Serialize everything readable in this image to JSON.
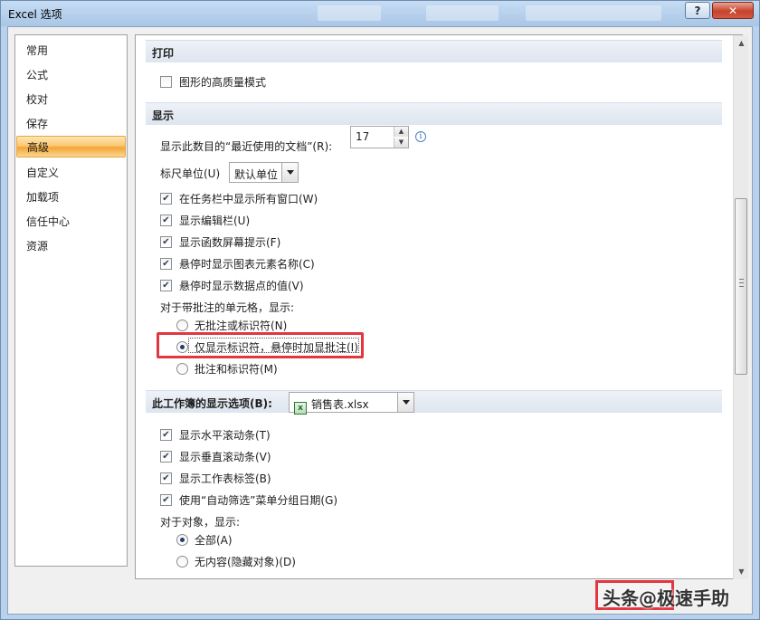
{
  "window": {
    "title": "Excel 选项",
    "help_label": "?",
    "close_label": "✕"
  },
  "nav": {
    "items": [
      {
        "label": "常用",
        "active": false
      },
      {
        "label": "公式",
        "active": false
      },
      {
        "label": "校对",
        "active": false
      },
      {
        "label": "保存",
        "active": false
      },
      {
        "label": "高级",
        "active": true
      },
      {
        "label": "自定义",
        "active": false
      },
      {
        "label": "加载项",
        "active": false
      },
      {
        "label": "信任中心",
        "active": false
      },
      {
        "label": "资源",
        "active": false
      }
    ]
  },
  "print_section": {
    "title": "打印",
    "high_quality_graphics": {
      "label": "图形的高质量模式",
      "checked": false
    }
  },
  "display_section": {
    "title": "显示",
    "recent_docs_label": "显示此数目的“最近使用的文档”(R):",
    "recent_docs_value": "17",
    "ruler_units_label": "标尺单位(U)",
    "ruler_units_value": "默认单位",
    "checkboxes": [
      {
        "label": "在任务栏中显示所有窗口(W)",
        "checked": true
      },
      {
        "label": "显示编辑栏(U)",
        "checked": true
      },
      {
        "label": "显示函数屏幕提示(F)",
        "checked": true
      },
      {
        "label": "悬停时显示图表元素名称(C)",
        "checked": true
      },
      {
        "label": "悬停时显示数据点的值(V)",
        "checked": true
      }
    ],
    "comments_label": "对于带批注的单元格，显示:",
    "comment_options": [
      {
        "label": "无批注或标识符(N)",
        "selected": false
      },
      {
        "label": "仅显示标识符，悬停时加显批注(I)",
        "selected": true
      },
      {
        "label": "批注和标识符(M)",
        "selected": false
      }
    ]
  },
  "workbook_section": {
    "title": "此工作簿的显示选项(B):",
    "workbook_value": "销售表.xlsx",
    "checkboxes": [
      {
        "label": "显示水平滚动条(T)",
        "checked": true
      },
      {
        "label": "显示垂直滚动条(V)",
        "checked": true
      },
      {
        "label": "显示工作表标签(B)",
        "checked": true
      },
      {
        "label": "使用“自动筛选”菜单分组日期(G)",
        "checked": true
      }
    ],
    "objects_label": "对于对象，显示:",
    "object_options": [
      {
        "label": "全部(A)",
        "selected": true
      },
      {
        "label": "无内容(隐藏对象)(D)",
        "selected": false
      }
    ]
  },
  "icons": {
    "checkmark": "✔",
    "info": "i",
    "spin_up": "▲",
    "spin_down": "▼",
    "excel_file": "x"
  },
  "watermark": {
    "text": "头条@极速手助"
  },
  "colors": {
    "highlight": "#e2373f",
    "nav_active": "#fbc870"
  }
}
